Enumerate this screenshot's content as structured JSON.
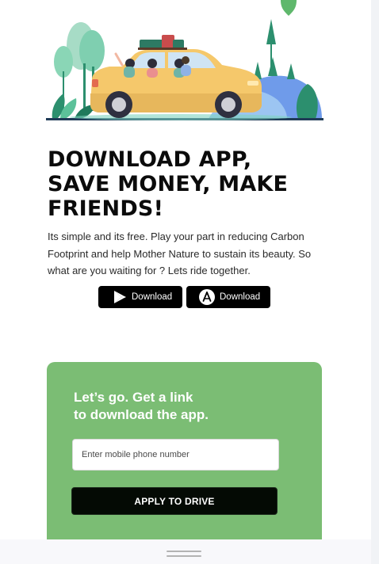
{
  "hero": {
    "illustration": "family-road-trip-car"
  },
  "heading": {
    "line1": "DOWNLOAD APP,",
    "line2": "SAVE MONEY, MAKE",
    "line3": "FRIENDS!"
  },
  "description": "Its simple and its free. Play your part in reducing Carbon Footprint and help Mother Nature to sustain its beauty. So what are you waiting for ? Lets ride together.",
  "downloads": {
    "play_label": "Download",
    "play_icon": "google-play-icon",
    "store_label": "Download",
    "store_icon": "app-store-icon"
  },
  "signup": {
    "title_line1": "Let’s go. Get a link",
    "title_line2": "to download the app.",
    "phone_placeholder": "Enter mobile phone number",
    "apply_label": "APPLY TO DRIVE"
  },
  "colors": {
    "card_bg": "#7bbd74",
    "car": "#f5c86b",
    "button_bg": "#000000"
  }
}
